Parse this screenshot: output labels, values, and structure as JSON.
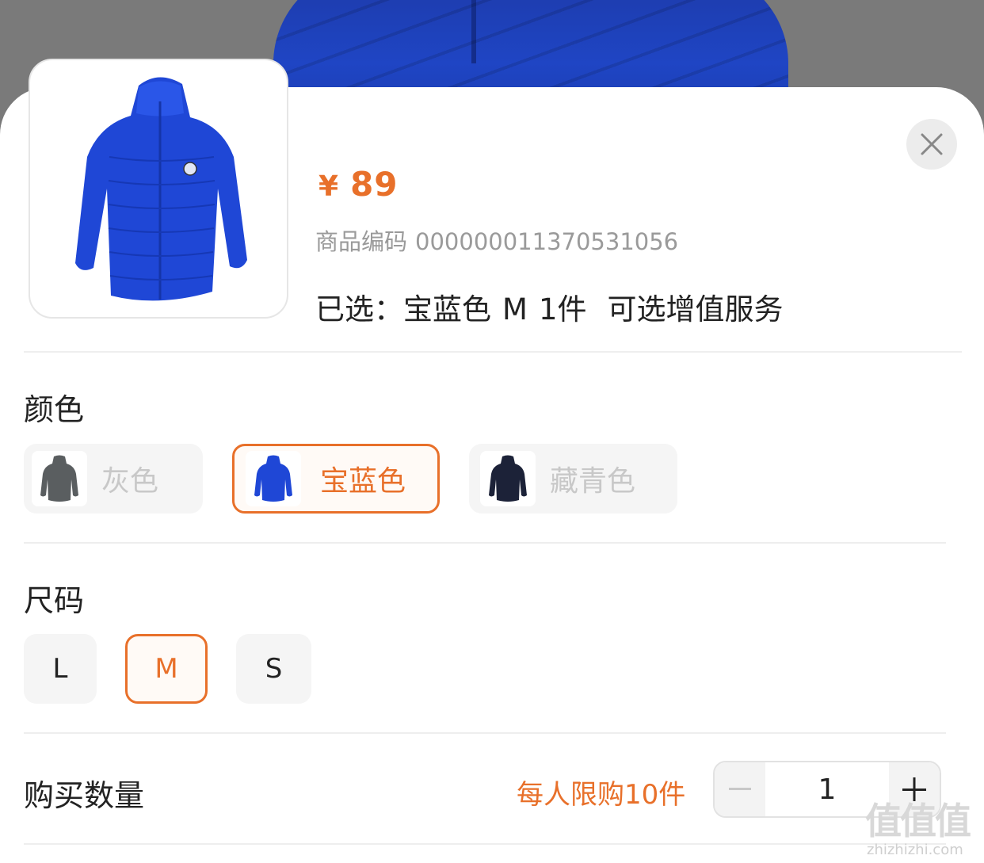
{
  "product": {
    "price_currency": "¥",
    "price_value": "89",
    "sku_label": "商品编码",
    "sku_value": "000000011370531056",
    "selected_prefix": "已选：",
    "selected_color": "宝蓝色",
    "selected_size": "M",
    "selected_qty": "1件",
    "service_text": "可选增值服务"
  },
  "color_section": {
    "title": "颜色",
    "options": [
      {
        "label": "灰色",
        "selected": false,
        "swatch": "#5a5e60"
      },
      {
        "label": "宝蓝色",
        "selected": true,
        "swatch": "#1f47d6"
      },
      {
        "label": "藏青色",
        "selected": false,
        "swatch": "#1c2238"
      }
    ]
  },
  "size_section": {
    "title": "尺码",
    "options": [
      {
        "label": "L",
        "selected": false
      },
      {
        "label": "M",
        "selected": true
      },
      {
        "label": "S",
        "selected": false
      }
    ]
  },
  "quantity_section": {
    "title": "购买数量",
    "limit_text": "每人限购10件",
    "value": "1",
    "minus_icon": "minus-icon",
    "plus_icon": "plus-icon"
  },
  "colors": {
    "accent": "#e8702a",
    "jacket_blue": "#1f47d6"
  },
  "icons": {
    "close": "close-icon"
  },
  "watermark": {
    "mark": "值值值",
    "site": "zhizhizhi.com"
  }
}
